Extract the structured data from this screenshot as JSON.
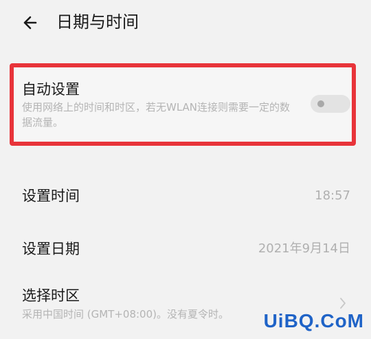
{
  "header": {
    "title": "日期与时间"
  },
  "auto_setting": {
    "title": "自动设置",
    "description": "使用网络上的时间和时区，若无WLAN连接则需要一定的数据流量。",
    "enabled": false
  },
  "rows": [
    {
      "label": "设置时间",
      "value": "18:57"
    },
    {
      "label": "设置日期",
      "value": "2021年9月14日"
    },
    {
      "label": "选择时区",
      "subtitle": "采用中国时间 (GMT+08:00)。没有夏令时。"
    }
  ],
  "watermark": {
    "text": "UiBQ.CoM"
  },
  "colors": {
    "highlight": "#e8343a",
    "watermark": "#1f63c7",
    "accent_text": "#1a1a1a"
  }
}
